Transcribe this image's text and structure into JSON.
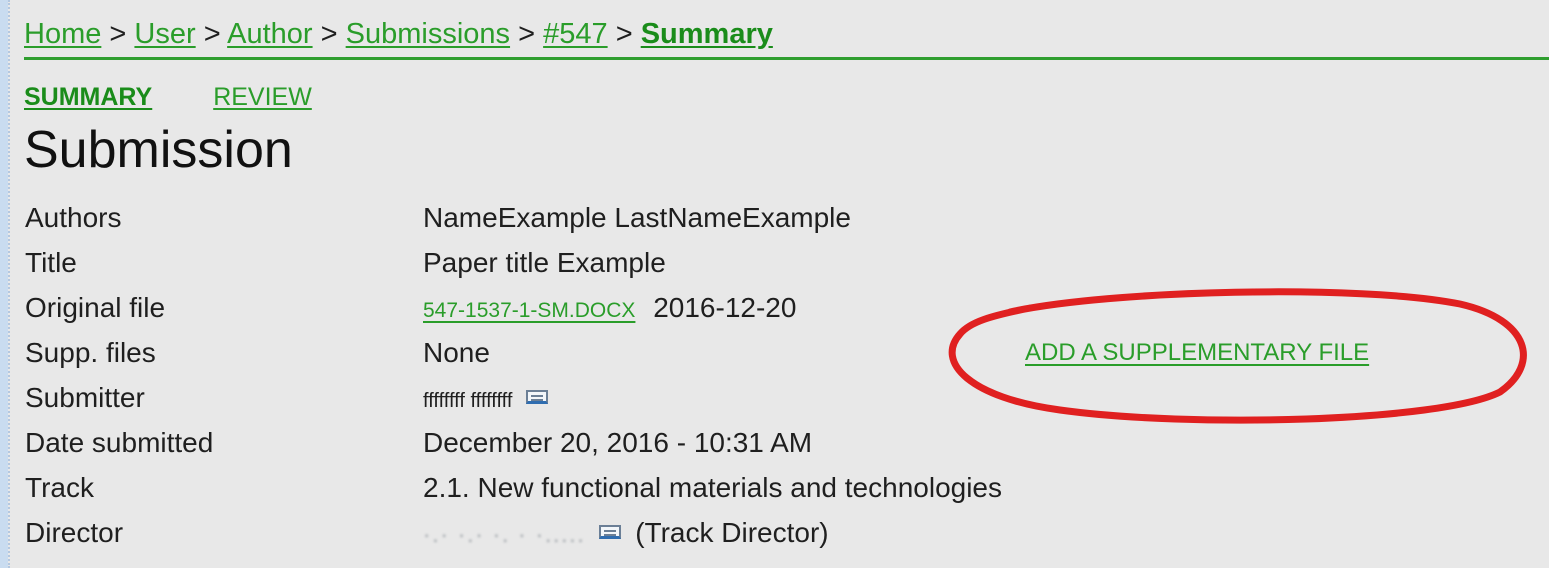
{
  "breadcrumb": {
    "home": "Home",
    "user": "User",
    "author": "Author",
    "submissions": "Submissions",
    "id": "#547",
    "current": "Summary",
    "sep": ">"
  },
  "tabs": [
    {
      "label": "SUMMARY"
    },
    {
      "label": "REVIEW"
    }
  ],
  "page_title": "Submission",
  "details": {
    "authors_label": "Authors",
    "authors_value": "NameExample LastNameExample",
    "title_label": "Title",
    "title_value": "Paper title Example",
    "original_label": "Original file",
    "original_file": "547-1537-1-SM.DOCX",
    "original_date": "2016-12-20",
    "supp_label": "Supp. files",
    "supp_value": "None",
    "submitter_label": "Submitter",
    "submitter_value": "ffffffff ffffffff",
    "date_label": "Date submitted",
    "date_value": "December 20, 2016 - 10:31 AM",
    "track_label": "Track",
    "track_value": "2.1. New functional materials and technologies",
    "director_label": "Director",
    "director_role": "(Track Director)"
  },
  "add_supp_file": "ADD A SUPPLEMENTARY FILE",
  "colors": {
    "link": "#2a9d2a",
    "annotation": "#e02020",
    "background": "#e8e8e8"
  }
}
